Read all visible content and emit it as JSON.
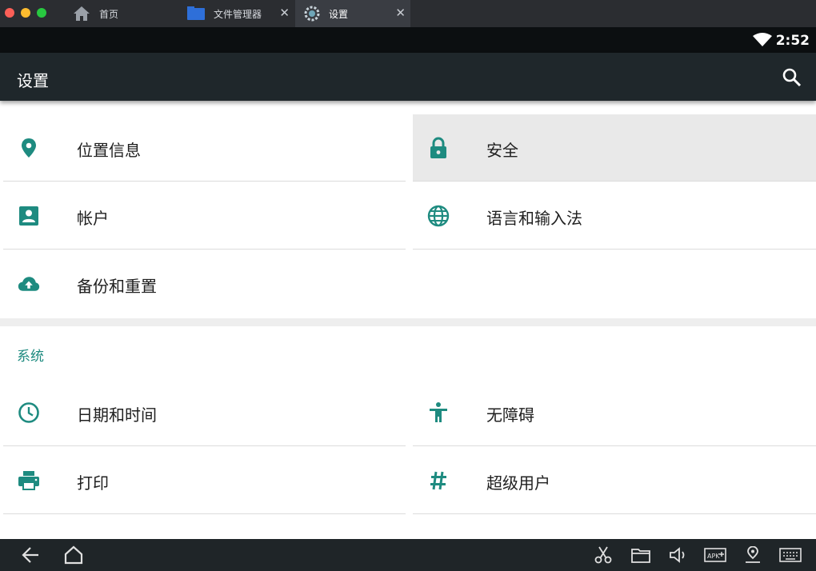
{
  "tabs": [
    {
      "label": "首页",
      "icon": "home-icon"
    },
    {
      "label": "文件管理器",
      "icon": "folder-icon",
      "close": "✕"
    },
    {
      "label": "设置",
      "icon": "gear-icon",
      "close": "✕"
    }
  ],
  "status": {
    "time": "2:52",
    "wifi_icon": "wifi-icon"
  },
  "appbar": {
    "title": "设置",
    "search_icon": "search-icon"
  },
  "accent_color": "#1e8b80",
  "personal": [
    {
      "label": "位置信息",
      "icon": "location-pin-icon"
    },
    {
      "label": "安全",
      "icon": "lock-icon",
      "highlighted": true
    },
    {
      "label": "帐户",
      "icon": "account-box-icon"
    },
    {
      "label": "语言和输入法",
      "icon": "globe-icon"
    },
    {
      "label": "备份和重置",
      "icon": "cloud-upload-icon"
    }
  ],
  "system": {
    "title": "系统",
    "items": [
      {
        "label": "日期和时间",
        "icon": "clock-icon"
      },
      {
        "label": "无障碍",
        "icon": "accessibility-icon"
      },
      {
        "label": "打印",
        "icon": "printer-icon"
      },
      {
        "label": "超级用户",
        "icon": "hash-icon"
      }
    ]
  },
  "navbar": {
    "left": [
      "back-icon",
      "home-icon"
    ],
    "right": [
      "scissors-icon",
      "folder-icon",
      "volume-icon",
      "apk-install-icon",
      "location-icon",
      "keyboard-icon"
    ]
  }
}
